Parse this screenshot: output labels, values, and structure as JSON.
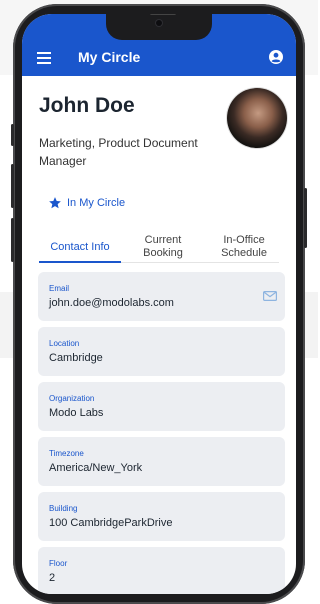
{
  "colors": {
    "brand": "#1a56cc",
    "card_bg": "#eceef2",
    "phone_body": "#1c1c1e"
  },
  "appbar": {
    "title": "My Circle",
    "menu_icon": "menu-icon",
    "account_icon": "account-icon"
  },
  "profile": {
    "name": "John Doe",
    "title": "Marketing, Product Document Manager",
    "circle_status": "In My Circle",
    "circle_icon": "star-icon"
  },
  "tabs": [
    {
      "label": "Contact Info",
      "active": true
    },
    {
      "label": "Current Booking",
      "active": false
    },
    {
      "label": "In-Office Schedule",
      "active": false
    }
  ],
  "contact": [
    {
      "label": "Email",
      "value": "john.doe@modolabs.com",
      "icon": "mail-icon"
    },
    {
      "label": "Location",
      "value": "Cambridge"
    },
    {
      "label": "Organization",
      "value": "Modo Labs"
    },
    {
      "label": "Timezone",
      "value": "America/New_York"
    },
    {
      "label": "Building",
      "value": "100 CambridgeParkDrive"
    },
    {
      "label": "Floor",
      "value": "2"
    }
  ]
}
